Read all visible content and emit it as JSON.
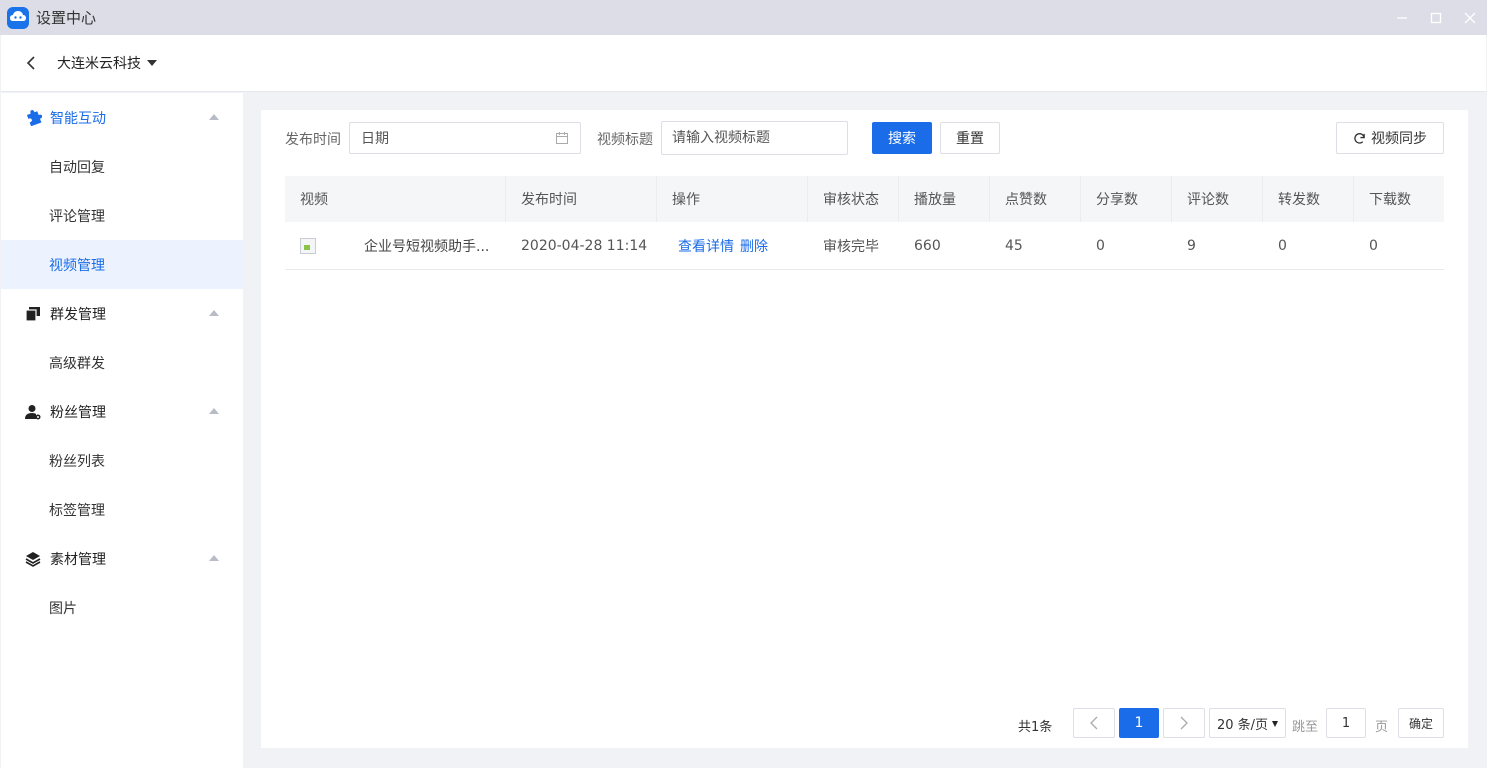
{
  "window": {
    "title": "设置中心"
  },
  "header": {
    "company": "大连米云科技"
  },
  "sidebar": {
    "groups": [
      {
        "label": "智能互动",
        "icon": "puzzle-icon",
        "items": [
          {
            "label": "自动回复"
          },
          {
            "label": "评论管理"
          },
          {
            "label": "视频管理"
          }
        ]
      },
      {
        "label": "群发管理",
        "icon": "messages-icon",
        "items": [
          {
            "label": "高级群发"
          }
        ]
      },
      {
        "label": "粉丝管理",
        "icon": "user-gear-icon",
        "items": [
          {
            "label": "粉丝列表"
          },
          {
            "label": "标签管理"
          }
        ]
      },
      {
        "label": "素材管理",
        "icon": "layers-icon",
        "items": [
          {
            "label": "图片"
          }
        ]
      }
    ],
    "active_item": "视频管理"
  },
  "filters": {
    "publish_time_label": "发布时间",
    "date_placeholder": "日期",
    "video_title_label": "视频标题",
    "video_title_placeholder": "请输入视频标题",
    "search_label": "搜索",
    "reset_label": "重置",
    "sync_label": "视频同步"
  },
  "table": {
    "columns": [
      "视频",
      "发布时间",
      "操作",
      "审核状态",
      "播放量",
      "点赞数",
      "分享数",
      "评论数",
      "转发数",
      "下载数"
    ],
    "rows": [
      {
        "title": "企业号短视频助手...",
        "publish_time": "2020-04-28 11:14",
        "action_view": "查看详情",
        "action_delete": "删除",
        "status": "审核完毕",
        "plays": "660",
        "likes": "45",
        "shares": "0",
        "comments": "9",
        "forwards": "0",
        "downloads": "0"
      }
    ]
  },
  "pagination": {
    "total": "共1条",
    "current_page": "1",
    "page_size": "20 条/页",
    "jump_label": "跳至",
    "jump_value": "1",
    "page_unit": "页",
    "confirm_label": "确定"
  },
  "colors": {
    "primary": "#1a6ce8",
    "titlebar": "#dcdde6",
    "active_bg": "#ecf3ff"
  }
}
